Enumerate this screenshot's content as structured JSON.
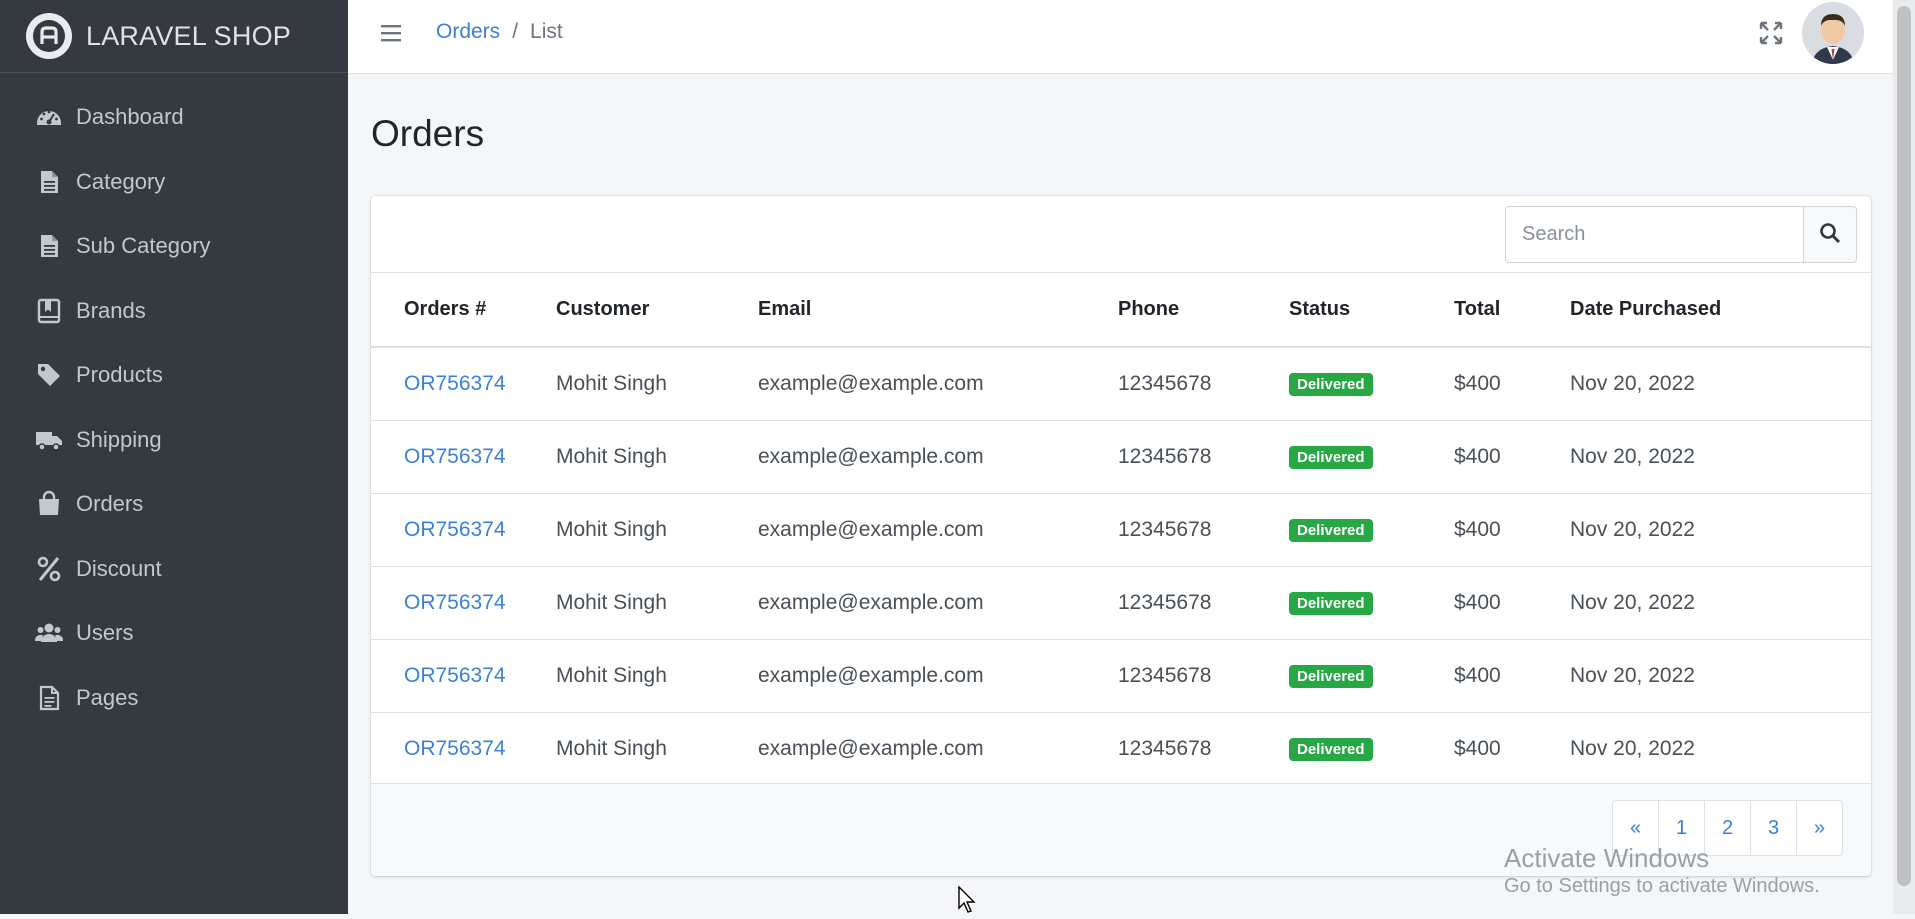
{
  "brand": {
    "name": "LARAVEL SHOP"
  },
  "sidebar": {
    "items": [
      {
        "label": "Dashboard",
        "icon": "dashboard-icon"
      },
      {
        "label": "Category",
        "icon": "file-icon"
      },
      {
        "label": "Sub Category",
        "icon": "file-icon"
      },
      {
        "label": "Brands",
        "icon": "bookmark-book-icon"
      },
      {
        "label": "Products",
        "icon": "tag-icon"
      },
      {
        "label": "Shipping",
        "icon": "truck-icon"
      },
      {
        "label": "Orders",
        "icon": "shopping-bag-icon"
      },
      {
        "label": "Discount",
        "icon": "percent-icon"
      },
      {
        "label": "Users",
        "icon": "users-icon"
      },
      {
        "label": "Pages",
        "icon": "file-lines-icon"
      }
    ]
  },
  "header": {
    "breadcrumb": {
      "link": "Orders",
      "separator": "/",
      "current": "List"
    }
  },
  "page": {
    "title": "Orders"
  },
  "search": {
    "placeholder": "Search"
  },
  "table": {
    "columns": [
      "Orders #",
      "Customer",
      "Email",
      "Phone",
      "Status",
      "Total",
      "Date Purchased"
    ],
    "rows": [
      {
        "order": "OR756374",
        "customer": "Mohit Singh",
        "email": "example@example.com",
        "phone": "12345678",
        "status": "Delivered",
        "total": "$400",
        "date": "Nov 20, 2022"
      },
      {
        "order": "OR756374",
        "customer": "Mohit Singh",
        "email": "example@example.com",
        "phone": "12345678",
        "status": "Delivered",
        "total": "$400",
        "date": "Nov 20, 2022"
      },
      {
        "order": "OR756374",
        "customer": "Mohit Singh",
        "email": "example@example.com",
        "phone": "12345678",
        "status": "Delivered",
        "total": "$400",
        "date": "Nov 20, 2022"
      },
      {
        "order": "OR756374",
        "customer": "Mohit Singh",
        "email": "example@example.com",
        "phone": "12345678",
        "status": "Delivered",
        "total": "$400",
        "date": "Nov 20, 2022"
      },
      {
        "order": "OR756374",
        "customer": "Mohit Singh",
        "email": "example@example.com",
        "phone": "12345678",
        "status": "Delivered",
        "total": "$400",
        "date": "Nov 20, 2022"
      },
      {
        "order": "OR756374",
        "customer": "Mohit Singh",
        "email": "example@example.com",
        "phone": "12345678",
        "status": "Delivered",
        "total": "$400",
        "date": "Nov 20, 2022"
      }
    ]
  },
  "pagination": {
    "prev": "«",
    "pages": [
      "1",
      "2",
      "3"
    ],
    "next": "»"
  },
  "watermark": {
    "title": "Activate Windows",
    "subtitle": "Go to Settings to activate Windows."
  },
  "colors": {
    "sidebar_bg": "#343a40",
    "link": "#3b82d6",
    "badge_success": "#28a745"
  }
}
